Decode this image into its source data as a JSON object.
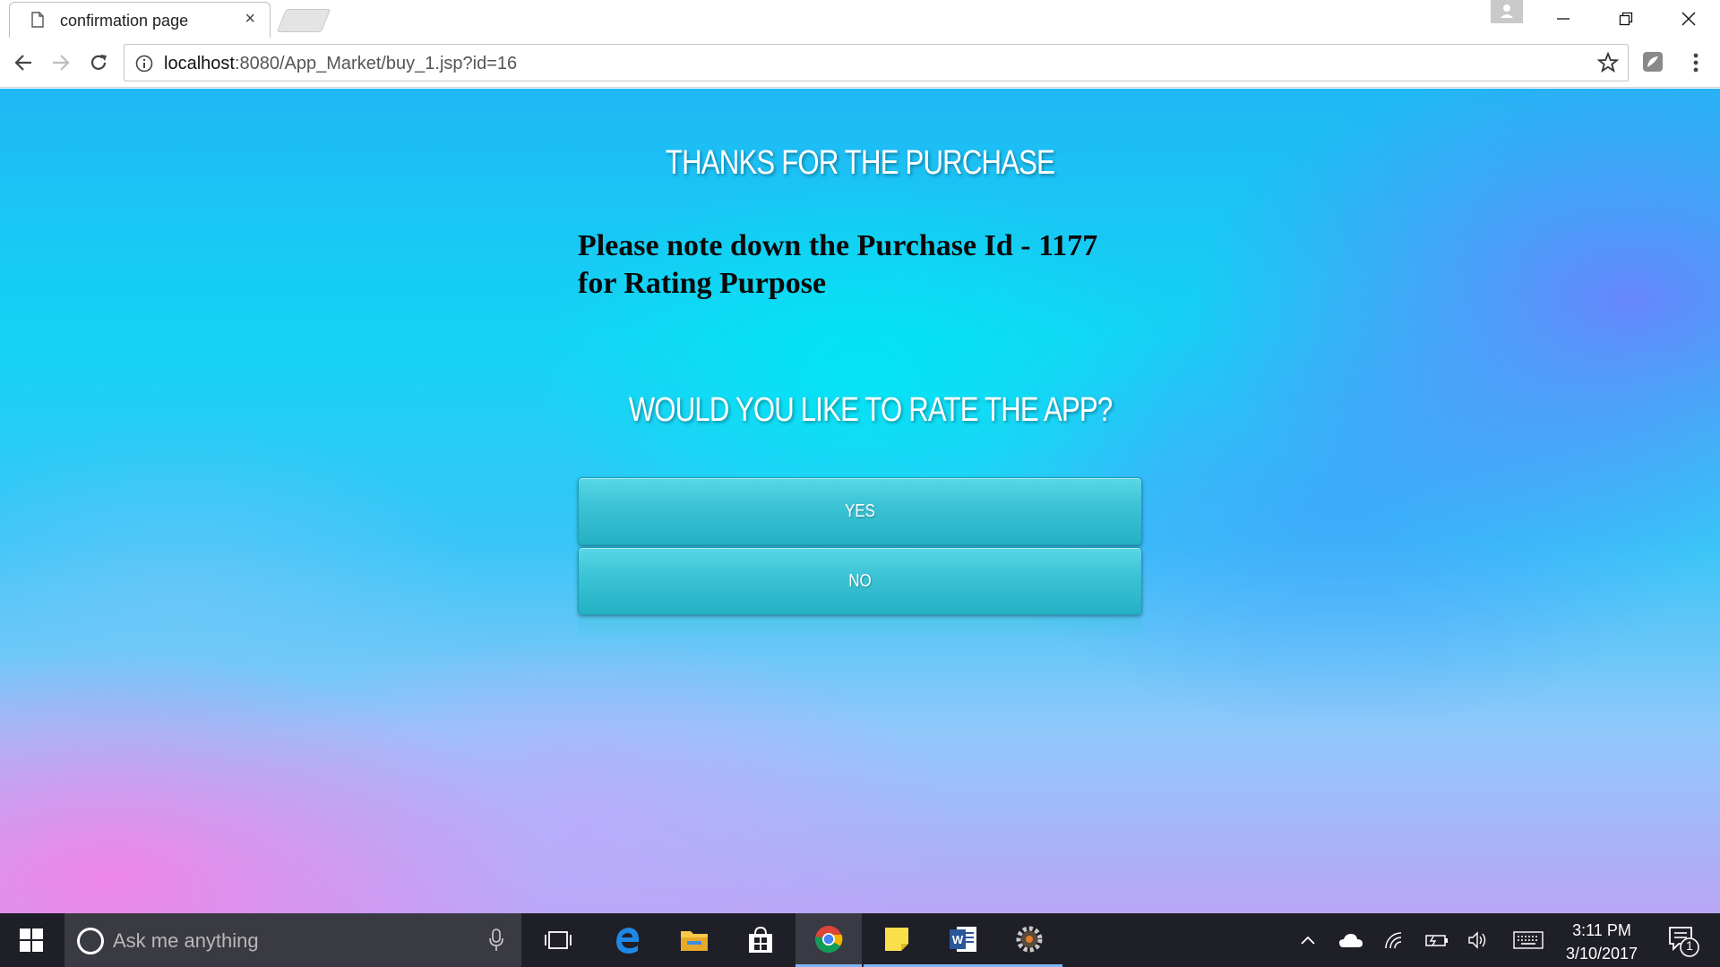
{
  "browser": {
    "tab_title": "confirmation page",
    "tab_close": "×",
    "url_host": "localhost",
    "url_path": ":8080/App_Market/buy_1.jsp?id=16"
  },
  "page": {
    "heading": "THANKS FOR THE PURCHASE",
    "note_line1": "Please note down the Purchase Id - 1177",
    "note_line2": "for Rating Purpose",
    "question": "WOULD YOU LIKE TO RATE THE APP?",
    "yes_label": "YES",
    "no_label": "NO"
  },
  "taskbar": {
    "search_placeholder": "Ask me anything",
    "time": "3:11 PM",
    "date": "3/10/2017",
    "notification_count": "1"
  },
  "icons": {
    "back": "back-arrow-icon",
    "forward": "forward-arrow-icon",
    "reload": "reload-icon",
    "info": "info-icon",
    "star": "bookmark-star-icon",
    "menu": "menu-dots-icon"
  },
  "colors": {
    "button_fill": "#3cc4d6",
    "taskbar": "#1f1f27",
    "text_dark": "#0a0a0a"
  }
}
